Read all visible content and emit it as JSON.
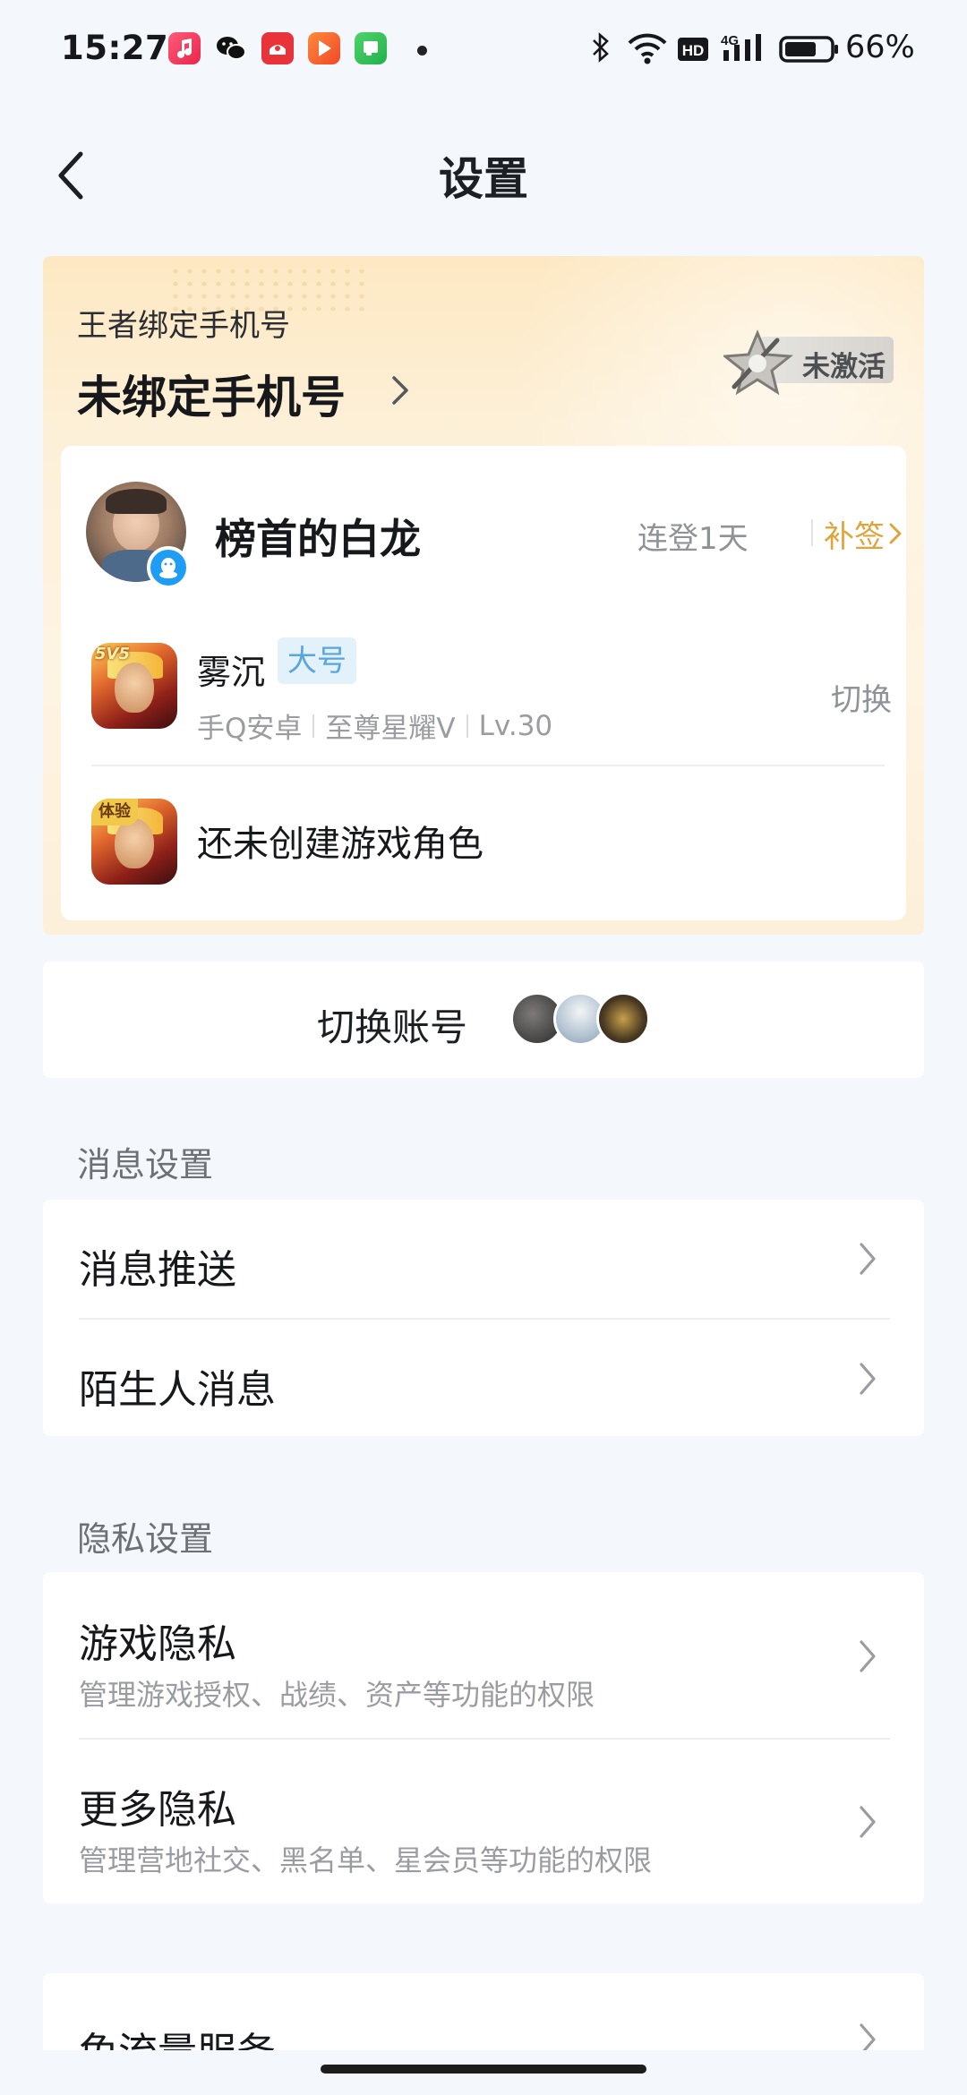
{
  "status_bar": {
    "time": "15:27",
    "battery": "66%",
    "app_icons": [
      "music-app-icon",
      "wechat-icon",
      "red-app-icon",
      "video-app-icon",
      "messages-app-icon"
    ],
    "system_icons": [
      "bluetooth-icon",
      "wifi-icon",
      "hd-icon",
      "signal-4g-icon",
      "battery-icon"
    ]
  },
  "header": {
    "title": "设置"
  },
  "binding": {
    "caption": "王者绑定手机号",
    "status": "未绑定手机号",
    "badge": "未激活"
  },
  "profile": {
    "nickname": "榜首的白龙",
    "login_streak": "连登1天",
    "makeup_sign": "补签"
  },
  "roles": [
    {
      "name": "雾沉",
      "tag": "大号",
      "icon_tag": "5V5",
      "platform": "手Q安卓",
      "rank": "至尊星耀V",
      "level": "Lv.30",
      "action": "切换"
    },
    {
      "icon_tag": "体验",
      "name": "还未创建游戏角色"
    }
  ],
  "switch_account": {
    "label": "切换账号"
  },
  "sections": {
    "message": {
      "title": "消息设置",
      "items": [
        {
          "title": "消息推送"
        },
        {
          "title": "陌生人消息"
        }
      ]
    },
    "privacy": {
      "title": "隐私设置",
      "items": [
        {
          "title": "游戏隐私",
          "subtitle": "管理游戏授权、战绩、资产等功能的权限"
        },
        {
          "title": "更多隐私",
          "subtitle": "管理营地社交、黑名单、星会员等功能的权限"
        }
      ]
    },
    "other": {
      "items": [
        {
          "title": "免流量服务"
        }
      ]
    }
  },
  "colors": {
    "accent_gold": "#e0a43a",
    "tag_blue": "#58a6dd",
    "page_bg": "#f4f7fb",
    "card_gold": "#fde8c2"
  }
}
